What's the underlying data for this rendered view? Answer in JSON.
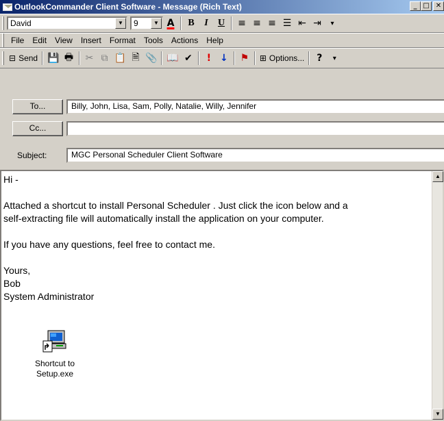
{
  "window": {
    "title": "OutlookCommander Client Software - Message (Rich Text)",
    "buttons": [
      "_",
      "□",
      "✕"
    ]
  },
  "format_toolbar": {
    "font_name": "David",
    "font_size": "9",
    "bold": "B",
    "italic": "I",
    "underline": "U"
  },
  "menu": {
    "items": [
      "File",
      "Edit",
      "View",
      "Insert",
      "Format",
      "Tools",
      "Actions",
      "Help"
    ]
  },
  "standard_toolbar": {
    "send_label": "Send",
    "options_label": "Options..."
  },
  "header": {
    "to_button": "To...",
    "to_value": "Billy, John, Lisa, Sam, Polly, Natalie, Willy, Jennifer",
    "cc_button": "Cc...",
    "cc_value": "",
    "subject_label": "Subject:",
    "subject_value": "MGC Personal Scheduler Client Software"
  },
  "message": {
    "greeting": "Hi -",
    "line1": "Attached a shortcut to install Personal Scheduler . Just click the icon below and a",
    "line2": "self-extracting file will automatically install the application on your computer.",
    "line3": "If you have any questions, feel free to contact me.",
    "closing": "Yours,",
    "name": "Bob",
    "role": "System Administrator"
  },
  "attachment": {
    "label_line1": "Shortcut to",
    "label_line2": "Setup.exe",
    "icon": "shortcut-setup-icon"
  },
  "colors": {
    "titlebar_start": "#0a246a",
    "titlebar_end": "#a6caf0",
    "chrome": "#d4d0c8"
  }
}
